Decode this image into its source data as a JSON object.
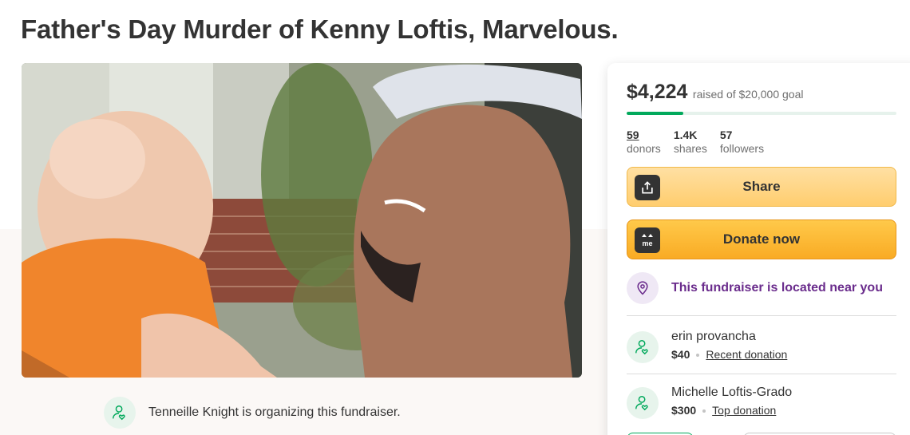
{
  "page": {
    "title": "Father's Day Murder of Kenny Loftis, Marvelous."
  },
  "organizer": {
    "text": "Tenneille Knight is organizing this fundraiser.",
    "icon": "person-heart-icon"
  },
  "sidebar": {
    "raised": "$4,224",
    "goal_text": "raised of $20,000 goal",
    "progress_fraction": 0.2112,
    "stats": [
      {
        "value": "59",
        "label": "donors"
      },
      {
        "value": "1.4K",
        "label": "shares"
      },
      {
        "value": "57",
        "label": "followers"
      }
    ],
    "share_label": "Share",
    "donate_label": "Donate now",
    "donate_icon_text": "me",
    "near_text": "This fundraiser is located near you",
    "donations": [
      {
        "name": "erin provancha",
        "amount": "$40",
        "tag": "Recent donation"
      },
      {
        "name": "Michelle Loftis-Grado",
        "amount": "$300",
        "tag": "Top donation"
      }
    ]
  },
  "colors": {
    "brand_green": "#02a95c",
    "accent_purple": "#6a2c8c",
    "share_yellow": "#ffcd6e",
    "donate_orange": "#f9ab24"
  }
}
